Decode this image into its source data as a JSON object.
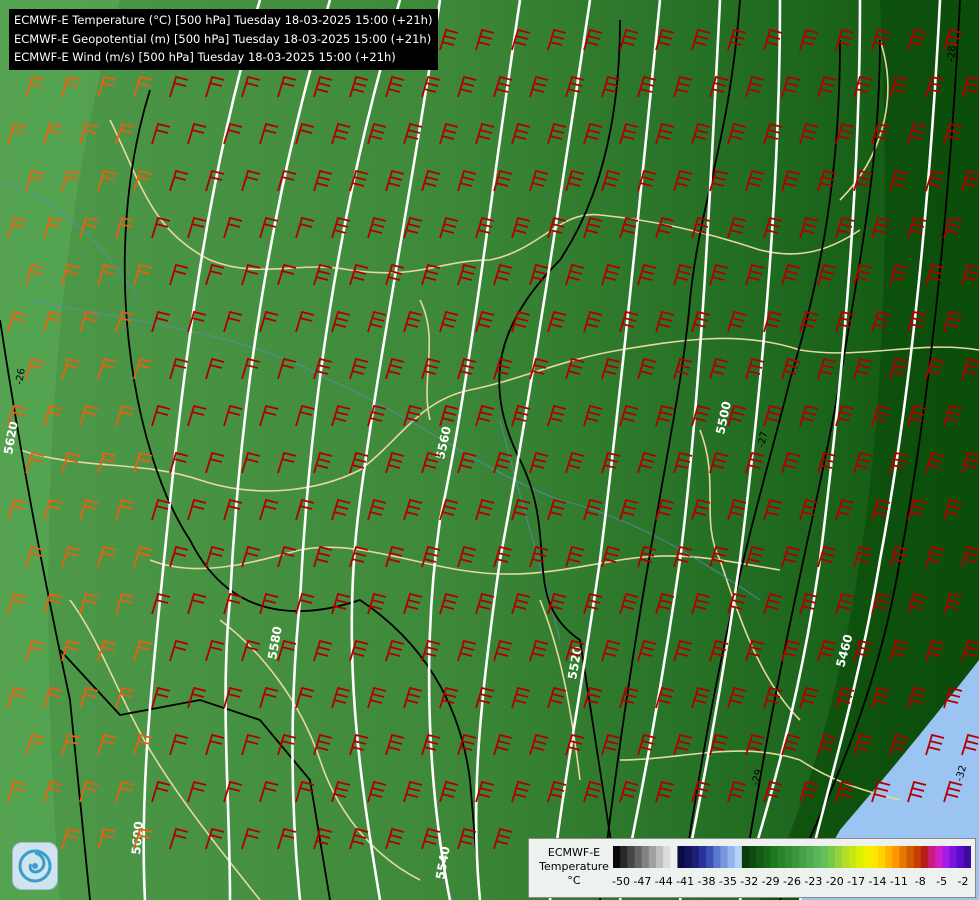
{
  "titles": [
    "ECMWF-E Temperature (°C) [500 hPa] Tuesday 18-03-2025 15:00 (+21h)",
    "ECMWF-E Geopotential (m) [500 hPa] Tuesday 18-03-2025 15:00 (+21h)",
    "ECMWF-E Wind (m/s) [500 hPa] Tuesday 18-03-2025 15:00 (+21h)"
  ],
  "legend": {
    "title_lines": [
      "ECMWF-E",
      "Temperature",
      "°C"
    ],
    "ticks": [
      "-50",
      "-47",
      "-44",
      "-41",
      "-38",
      "-35",
      "-32",
      "-29",
      "-26",
      "-23",
      "-20",
      "-17",
      "-14",
      "-11",
      "-8",
      "-5",
      "-2"
    ],
    "colors": [
      "#0a0a0a",
      "#282828",
      "#464646",
      "#646464",
      "#828282",
      "#a0a0a0",
      "#bebebe",
      "#dcdcdc",
      "#f0f0f0",
      "#0a0a46",
      "#14145a",
      "#1e1e78",
      "#28329a",
      "#3c50b4",
      "#5a78cc",
      "#7896dc",
      "#96b4ec",
      "#b4d2f8",
      "#0a3c0a",
      "#0f4b0f",
      "#145a14",
      "#196919",
      "#1e7820",
      "#288228",
      "#328c32",
      "#3c963c",
      "#46a046",
      "#50aa50",
      "#5ab45a",
      "#64be5a",
      "#78c84b",
      "#96d23c",
      "#b4dc28",
      "#c8e614",
      "#dcf000",
      "#f0f000",
      "#ffe600",
      "#ffd200",
      "#ffb400",
      "#ff9600",
      "#e67800",
      "#d25a00",
      "#c83c00",
      "#b41e1e",
      "#c81e78",
      "#d21ec8",
      "#a01ee6",
      "#7814dc",
      "#5a0ac8",
      "#3c0aa0"
    ]
  },
  "geopotential_labels": [
    "5620",
    "5600",
    "5580",
    "5560",
    "5540",
    "5520",
    "5500",
    "5460"
  ],
  "temperature_labels": [
    "-26",
    "-27",
    "-28",
    "-29",
    "-32"
  ],
  "icons": {
    "logo": "weather-swirl-icon"
  },
  "colors": {
    "wind_barb": "#b00000",
    "wind_barb_light": "#e86010",
    "geopotential": "#ffffff",
    "isotherm": "#000000",
    "border": "#e8d8a0"
  }
}
